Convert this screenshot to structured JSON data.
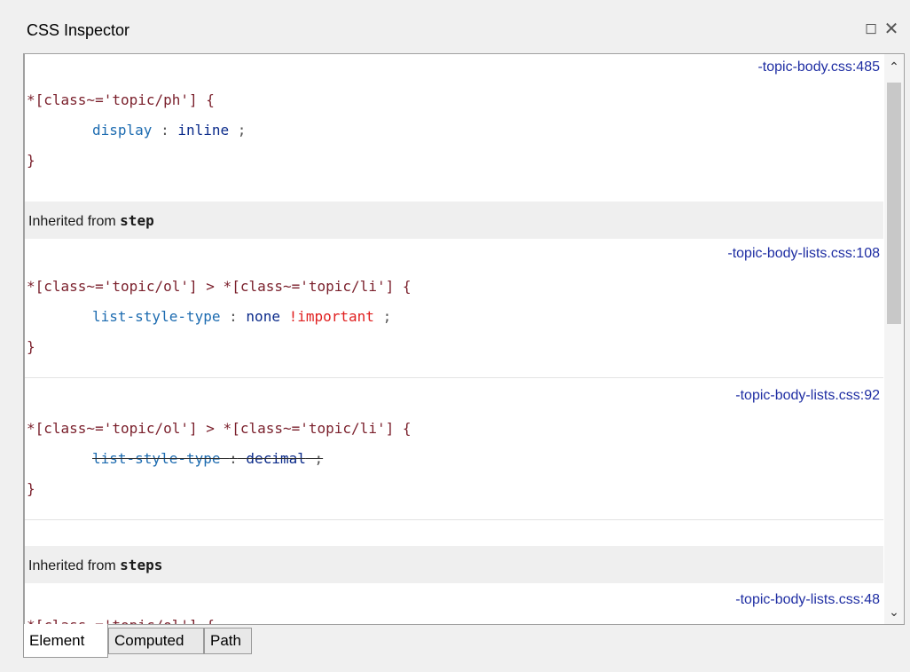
{
  "panel": {
    "title": "CSS Inspector",
    "restore_glyph": "◻",
    "close_glyph": "✕"
  },
  "rules": [
    {
      "source": "-topic-body.css:485",
      "selector": "*[class~='topic/ph']",
      "open_brace": "{",
      "close_brace": "}",
      "declarations": [
        {
          "property": "display",
          "value": "inline",
          "important": "",
          "overridden": false
        }
      ]
    },
    {
      "inherited_label": "Inherited from",
      "inherited_element": "step",
      "source": "-topic-body-lists.css:108",
      "selector": "*[class~='topic/ol'] > *[class~='topic/li']",
      "open_brace": "{",
      "close_brace": "}",
      "declarations": [
        {
          "property": "list-style-type",
          "value": "none",
          "important": "!important",
          "overridden": false
        }
      ]
    },
    {
      "source": "-topic-body-lists.css:92",
      "selector": "*[class~='topic/ol'] > *[class~='topic/li']",
      "open_brace": "{",
      "close_brace": "}",
      "declarations": [
        {
          "property": "list-style-type",
          "value": "decimal",
          "important": "",
          "overridden": true
        }
      ]
    },
    {
      "inherited_label": "Inherited from",
      "inherited_element": "steps",
      "source": "-topic-body-lists.css:48",
      "selector": "*[class~='topic/ol']",
      "open_brace": "{"
    }
  ],
  "punct": {
    "colon": ":",
    "semicolon": ";"
  },
  "scroll": {
    "up_glyph": "⌃",
    "down_glyph": "⌄"
  },
  "tabs": [
    {
      "label": "Element",
      "active": true
    },
    {
      "label": "Computed",
      "active": false
    },
    {
      "label": "Path",
      "active": false
    }
  ]
}
